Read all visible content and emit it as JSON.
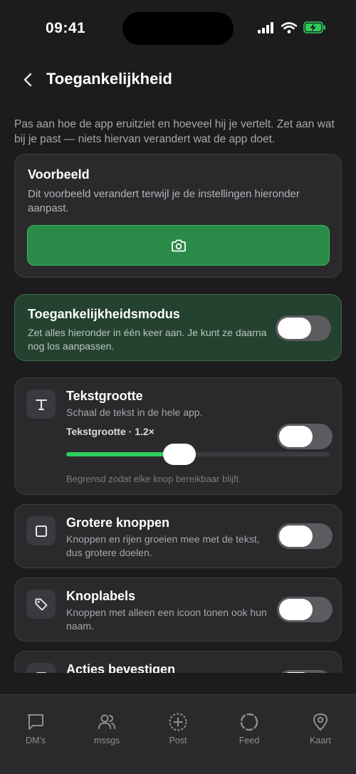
{
  "status": {
    "time": "09:41"
  },
  "nav": {
    "title": "Toegankelijkheid"
  },
  "intro": "Pas aan hoe de app eruitziet en hoeveel hij je vertelt. Zet aan wat bij je past — niets hiervan verandert wat de app doet.",
  "preview": {
    "title": "Voorbeeld",
    "description": "Dit voorbeeld verandert terwijl je de instellingen hieronder aanpast.",
    "button_icon": "camera-icon"
  },
  "mode": {
    "title": "Toegankelijkheidsmodus",
    "description": "Zet alles hieronder in één keer aan. Je kunt ze daarna nog los aanpassen.",
    "enabled": false
  },
  "text_size": {
    "icon": "text-icon",
    "title": "Tekstgrootte",
    "description": "Schaal de tekst in de hele app.",
    "slider_label": "Tekstgrootte · 1.2×",
    "slider_value_fraction": 0.43,
    "toggle_enabled": false,
    "note": "Begrensd zodat elke knop bereikbaar blijft."
  },
  "larger_buttons": {
    "icon": "square-icon",
    "title": "Grotere knoppen",
    "description": "Knoppen en rijen groeien mee met de tekst, dus grotere doelen.",
    "enabled": false
  },
  "button_labels": {
    "icon": "tag-icon",
    "title": "Knoplabels",
    "description": "Knoppen met alleen een icoon tonen ook hun naam.",
    "enabled": false
  },
  "confirm_actions": {
    "icon": "confirm-icon",
    "title": "Acties bevestigen"
  },
  "tabs": [
    {
      "label": "DM's",
      "icon": "chat-icon"
    },
    {
      "label": "mssgs",
      "icon": "people-icon"
    },
    {
      "label": "Post",
      "icon": "plus-circle-icon"
    },
    {
      "label": "Feed",
      "icon": "circle-icon"
    },
    {
      "label": "Kaart",
      "icon": "map-pin-icon"
    }
  ],
  "colors": {
    "background": "#1c1c1e",
    "accent_green": "#2fcc5c",
    "preview_button": "#2a8a48",
    "mode_card": "#24422f"
  }
}
